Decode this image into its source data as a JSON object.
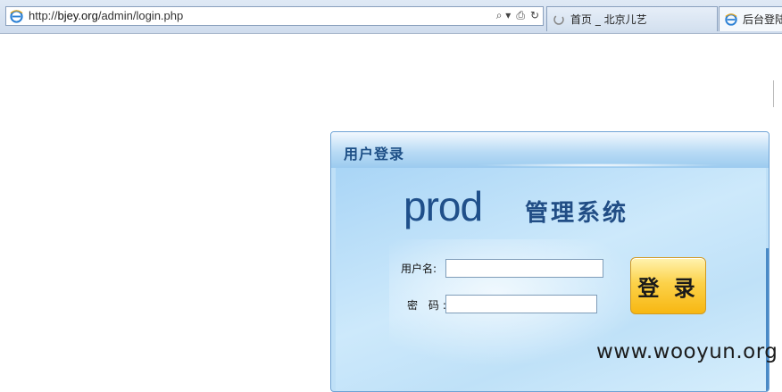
{
  "browser": {
    "url_prefix": "http://",
    "url_domain": "bjey.org",
    "url_path": "/admin/login.php",
    "tabs": [
      {
        "label": "首页 _ 北京儿艺"
      },
      {
        "label": "后台登陆"
      }
    ],
    "addr_tools": [
      "⌕ ▾",
      "⎙",
      "↻"
    ]
  },
  "login_panel": {
    "title": "用户登录",
    "brand": "prod",
    "system_name": "管理系统",
    "username_label": "用户名:",
    "username_value": "",
    "password_label": "密 码:",
    "password_value": "",
    "submit_label": "登 录"
  },
  "watermark": "www.wooyun.org",
  "colors": {
    "panel_border": "#6ea3d5",
    "panel_bg": "#bfe0f7",
    "title_color": "#1d4f86",
    "button_gold": "#f7b712"
  }
}
